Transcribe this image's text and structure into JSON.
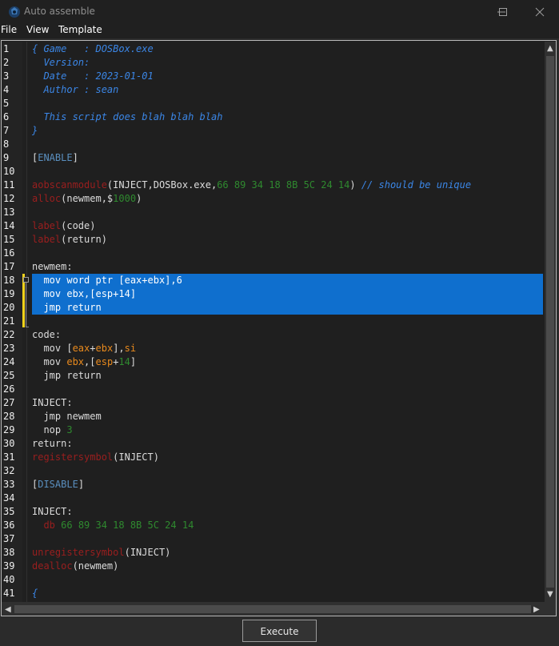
{
  "window": {
    "title": "Auto assemble",
    "icon": "cheat-engine-icon",
    "controls": [
      "minimize-icon",
      "maximize-icon",
      "close-icon"
    ]
  },
  "menu": [
    "File",
    "View",
    "Template"
  ],
  "editor": {
    "selected_lines": [
      18,
      20
    ],
    "changed_lines": [
      18,
      21
    ],
    "lines": [
      {
        "n": "1",
        "segments": [
          {
            "t": "{ Game   : DOSBox.exe",
            "c": "c-comment"
          }
        ]
      },
      {
        "n": "2",
        "segments": [
          {
            "t": "  Version:",
            "c": "c-comment"
          }
        ]
      },
      {
        "n": "3",
        "segments": [
          {
            "t": "  Date   : 2023-01-01",
            "c": "c-comment"
          }
        ]
      },
      {
        "n": "4",
        "segments": [
          {
            "t": "  Author : sean",
            "c": "c-comment"
          }
        ]
      },
      {
        "n": "5",
        "segments": []
      },
      {
        "n": "6",
        "segments": [
          {
            "t": "  This script does blah blah blah",
            "c": "c-comment"
          }
        ]
      },
      {
        "n": "7",
        "segments": [
          {
            "t": "}",
            "c": "c-comment"
          }
        ]
      },
      {
        "n": "8",
        "segments": []
      },
      {
        "n": "9",
        "segments": [
          {
            "t": "[",
            "c": ""
          },
          {
            "t": "ENABLE",
            "c": "c-section"
          },
          {
            "t": "]",
            "c": ""
          }
        ]
      },
      {
        "n": "10",
        "segments": []
      },
      {
        "n": "11",
        "segments": [
          {
            "t": "aobscanmodule",
            "c": "c-func"
          },
          {
            "t": "(INJECT,DOSBox.exe,",
            "c": ""
          },
          {
            "t": "66 89 34 18 8B 5C 24 14",
            "c": "c-num"
          },
          {
            "t": ") ",
            "c": ""
          },
          {
            "t": "// should be unique",
            "c": "c-comment"
          }
        ]
      },
      {
        "n": "12",
        "segments": [
          {
            "t": "alloc",
            "c": "c-func"
          },
          {
            "t": "(newmem,$",
            "c": ""
          },
          {
            "t": "1000",
            "c": "c-num"
          },
          {
            "t": ")",
            "c": ""
          }
        ]
      },
      {
        "n": "13",
        "segments": []
      },
      {
        "n": "14",
        "segments": [
          {
            "t": "label",
            "c": "c-func"
          },
          {
            "t": "(code)",
            "c": ""
          }
        ]
      },
      {
        "n": "15",
        "segments": [
          {
            "t": "label",
            "c": "c-func"
          },
          {
            "t": "(return)",
            "c": ""
          }
        ]
      },
      {
        "n": "16",
        "segments": []
      },
      {
        "n": "17",
        "segments": [
          {
            "t": "newmem:",
            "c": ""
          }
        ]
      },
      {
        "n": "18",
        "segments": [
          {
            "t": "  mov word ptr [eax+ebx],6",
            "c": ""
          }
        ]
      },
      {
        "n": "19",
        "segments": [
          {
            "t": "  mov ebx,[esp+14]",
            "c": ""
          }
        ]
      },
      {
        "n": "20",
        "segments": [
          {
            "t": "  jmp return",
            "c": ""
          }
        ]
      },
      {
        "n": "21",
        "segments": []
      },
      {
        "n": "22",
        "segments": [
          {
            "t": "code:",
            "c": ""
          }
        ]
      },
      {
        "n": "23",
        "segments": [
          {
            "t": "  mov [",
            "c": ""
          },
          {
            "t": "eax",
            "c": "c-reg"
          },
          {
            "t": "+",
            "c": ""
          },
          {
            "t": "ebx",
            "c": "c-reg"
          },
          {
            "t": "],",
            "c": ""
          },
          {
            "t": "si",
            "c": "c-reg"
          }
        ]
      },
      {
        "n": "24",
        "segments": [
          {
            "t": "  mov ",
            "c": ""
          },
          {
            "t": "ebx",
            "c": "c-reg"
          },
          {
            "t": ",[",
            "c": ""
          },
          {
            "t": "esp",
            "c": "c-reg"
          },
          {
            "t": "+",
            "c": ""
          },
          {
            "t": "14",
            "c": "c-num"
          },
          {
            "t": "]",
            "c": ""
          }
        ]
      },
      {
        "n": "25",
        "segments": [
          {
            "t": "  jmp return",
            "c": ""
          }
        ]
      },
      {
        "n": "26",
        "segments": []
      },
      {
        "n": "27",
        "segments": [
          {
            "t": "INJECT:",
            "c": ""
          }
        ]
      },
      {
        "n": "28",
        "segments": [
          {
            "t": "  jmp newmem",
            "c": ""
          }
        ]
      },
      {
        "n": "29",
        "segments": [
          {
            "t": "  nop ",
            "c": ""
          },
          {
            "t": "3",
            "c": "c-num"
          }
        ]
      },
      {
        "n": "30",
        "segments": [
          {
            "t": "return:",
            "c": ""
          }
        ]
      },
      {
        "n": "31",
        "segments": [
          {
            "t": "registersymbol",
            "c": "c-func"
          },
          {
            "t": "(INJECT)",
            "c": ""
          }
        ]
      },
      {
        "n": "32",
        "segments": []
      },
      {
        "n": "33",
        "segments": [
          {
            "t": "[",
            "c": ""
          },
          {
            "t": "DISABLE",
            "c": "c-section"
          },
          {
            "t": "]",
            "c": ""
          }
        ]
      },
      {
        "n": "34",
        "segments": []
      },
      {
        "n": "35",
        "segments": [
          {
            "t": "INJECT:",
            "c": ""
          }
        ]
      },
      {
        "n": "36",
        "segments": [
          {
            "t": "  ",
            "c": ""
          },
          {
            "t": "db",
            "c": "c-func"
          },
          {
            "t": " ",
            "c": ""
          },
          {
            "t": "66 89 34 18 8B 5C 24 14",
            "c": "c-num"
          }
        ]
      },
      {
        "n": "37",
        "segments": []
      },
      {
        "n": "38",
        "segments": [
          {
            "t": "unregistersymbol",
            "c": "c-func"
          },
          {
            "t": "(INJECT)",
            "c": ""
          }
        ]
      },
      {
        "n": "39",
        "segments": [
          {
            "t": "dealloc",
            "c": "c-func"
          },
          {
            "t": "(newmem)",
            "c": ""
          }
        ]
      },
      {
        "n": "40",
        "segments": []
      },
      {
        "n": "41",
        "segments": [
          {
            "t": "{",
            "c": "c-comment"
          }
        ]
      }
    ]
  },
  "buttons": {
    "execute": "Execute"
  },
  "colors": {
    "selection": "#0f6fce",
    "change_marker": "#f2d31b",
    "comment": "#3b86e6",
    "function": "#9b1f1f",
    "number": "#2f8a2f",
    "register": "#e98a1d"
  }
}
